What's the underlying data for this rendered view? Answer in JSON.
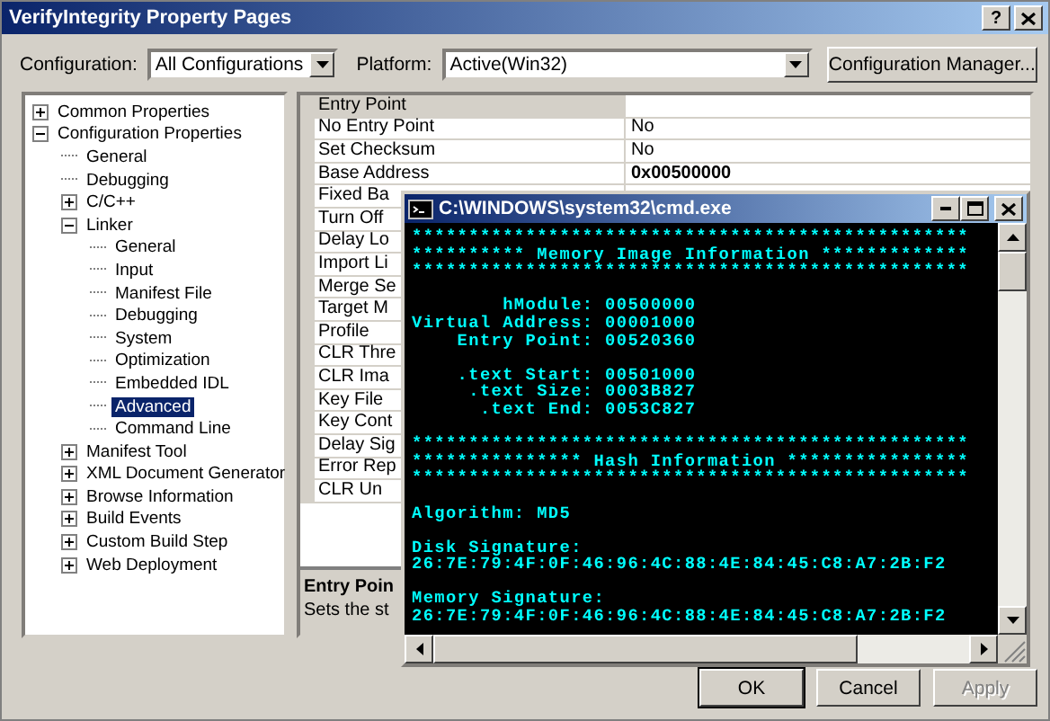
{
  "window": {
    "title": "VerifyIntegrity Property Pages",
    "help": "?"
  },
  "toolbar": {
    "configuration": {
      "label": "Configuration:",
      "value": "All Configurations"
    },
    "platform": {
      "label": "Platform:",
      "value": "Active(Win32)"
    },
    "manager_button": "Configuration Manager..."
  },
  "tree": [
    {
      "label": "Common Properties",
      "expanded": false,
      "selected": false
    },
    {
      "label": "Configuration Properties",
      "expanded": true,
      "selected": false,
      "children": [
        {
          "label": "General",
          "selected": false
        },
        {
          "label": "Debugging",
          "selected": false
        },
        {
          "label": "C/C++",
          "expanded": false,
          "selected": false
        },
        {
          "label": "Linker",
          "expanded": true,
          "selected": false,
          "children": [
            {
              "label": "General",
              "selected": false
            },
            {
              "label": "Input",
              "selected": false
            },
            {
              "label": "Manifest File",
              "selected": false
            },
            {
              "label": "Debugging",
              "selected": false
            },
            {
              "label": "System",
              "selected": false
            },
            {
              "label": "Optimization",
              "selected": false
            },
            {
              "label": "Embedded IDL",
              "selected": false
            },
            {
              "label": "Advanced",
              "selected": true
            },
            {
              "label": "Command Line",
              "selected": false
            }
          ]
        },
        {
          "label": "Manifest Tool",
          "expanded": false,
          "selected": false
        },
        {
          "label": "XML Document Generator",
          "expanded": false,
          "selected": false
        },
        {
          "label": "Browse Information",
          "expanded": false,
          "selected": false
        },
        {
          "label": "Build Events",
          "expanded": false,
          "selected": false
        },
        {
          "label": "Custom Build Step",
          "expanded": false,
          "selected": false
        },
        {
          "label": "Web Deployment",
          "expanded": false,
          "selected": false
        }
      ]
    }
  ],
  "properties": [
    {
      "name": "Entry Point",
      "selected": true
    },
    {
      "name": "No Entry Point",
      "value": "No",
      "selected": false
    },
    {
      "name": "Set Checksum",
      "value": "No",
      "selected": false
    },
    {
      "name": "Base Address",
      "value": "0x00500000",
      "bold": true,
      "selected": false
    },
    {
      "name": "Fixed Ba",
      "selected": false
    },
    {
      "name": "Turn Off",
      "selected": false
    },
    {
      "name": "Delay Lo",
      "selected": false
    },
    {
      "name": "Import Li",
      "selected": false
    },
    {
      "name": "Merge Se",
      "selected": false
    },
    {
      "name": "Target M",
      "selected": false
    },
    {
      "name": "Profile",
      "selected": false
    },
    {
      "name": "CLR Thre",
      "selected": false
    },
    {
      "name": "CLR Ima",
      "selected": false
    },
    {
      "name": "Key File",
      "selected": false
    },
    {
      "name": "Key Cont",
      "selected": false
    },
    {
      "name": "Delay Sig",
      "selected": false
    },
    {
      "name": "Error Rep",
      "selected": false
    },
    {
      "name": "CLR Un",
      "selected": false
    }
  ],
  "description": {
    "title": "Entry Poin",
    "text": "Sets the st"
  },
  "console": {
    "title": "C:\\WINDOWS\\system32\\cmd.exe",
    "blocks": [
      [
        "*************************************************",
        "********** Memory Image Information *************",
        "*************************************************"
      ],
      [
        "        hModule: 00500000",
        "Virtual Address: 00001000",
        "    Entry Point: 00520360"
      ],
      [
        "    .text Start: 00501000",
        "     .text Size: 0003B827",
        "      .text End: 0053C827"
      ],
      [
        "*************************************************",
        "*************** Hash Information ****************",
        "*************************************************"
      ],
      [
        "Algorithm: MD5"
      ],
      [
        "Disk Signature:",
        "26:7E:79:4F:0F:46:96:4C:88:4E:84:45:C8:A7:2B:F2"
      ],
      [
        "Memory Signature:",
        "26:7E:79:4F:0F:46:96:4C:88:4E:84:45:C8:A7:2B:F2"
      ]
    ]
  },
  "buttons": [
    {
      "label": "OK",
      "default": true,
      "disabled": false
    },
    {
      "label": "Cancel",
      "default": false,
      "disabled": false
    },
    {
      "label": "Apply",
      "default": false,
      "disabled": true
    }
  ]
}
